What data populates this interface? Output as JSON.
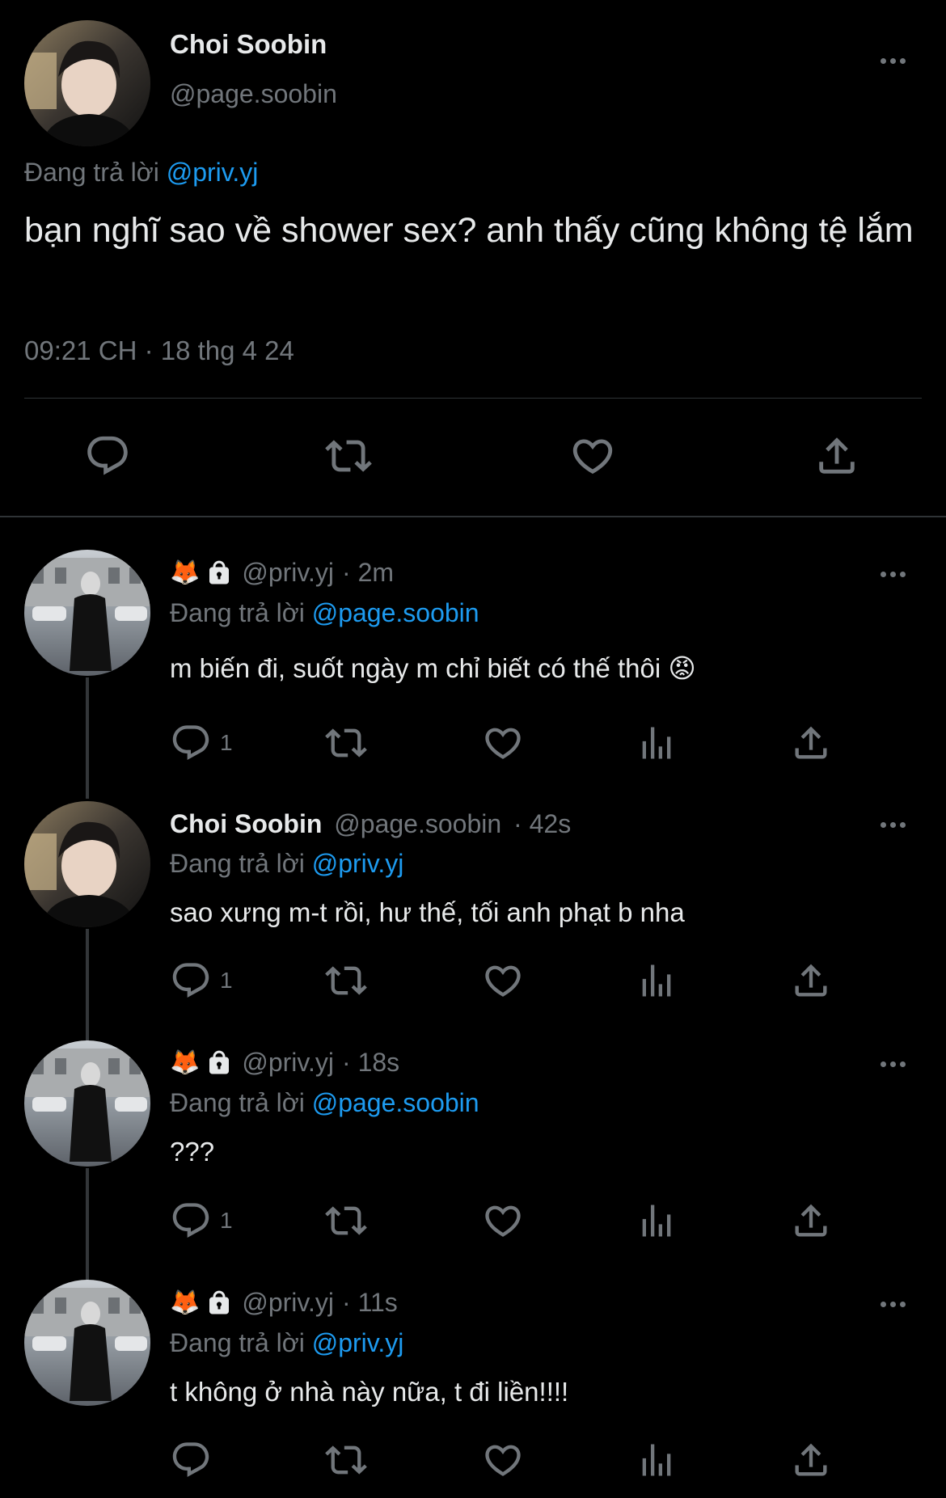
{
  "main": {
    "name": "Choi Soobin",
    "handle": "@page.soobin",
    "reply_prefix": "Đang trả lời",
    "reply_to": "@priv.yj",
    "text": "bạn nghĩ sao về shower sex? anh thấy cũng không tệ lắm",
    "timestamp": "09:21 CH · 18 thg 4 24"
  },
  "replies": [
    {
      "emoji": "🦊",
      "handle": "@priv.yj",
      "time": "· 2m",
      "reply_prefix": "Đang trả lời",
      "reply_to": "@page.soobin",
      "text": "m biến đi, suốt ngày m chỉ biết có thế thôi 😡",
      "reply_count": "1"
    },
    {
      "name": "Choi Soobin",
      "handle": "@page.soobin",
      "time": "· 42s",
      "reply_prefix": "Đang trả lời",
      "reply_to": "@priv.yj",
      "text": "sao xưng m-t rồi, hư thế, tối anh phạt b nha",
      "reply_count": "1"
    },
    {
      "emoji": "🦊",
      "handle": "@priv.yj",
      "time": "· 18s",
      "reply_prefix": "Đang trả lời",
      "reply_to": "@page.soobin",
      "text": "???",
      "reply_count": "1"
    },
    {
      "emoji": "🦊",
      "handle": "@priv.yj",
      "time": "· 11s",
      "reply_prefix": "Đang trả lời",
      "reply_to": "@priv.yj",
      "text": "t không ở nhà này nữa, t đi liền!!!!",
      "reply_count": ""
    }
  ],
  "icons": {
    "more": "more-icon",
    "reply": "reply-icon",
    "retweet": "retweet-icon",
    "like": "like-icon",
    "views": "views-icon",
    "share": "share-icon",
    "lock": "lock-icon"
  },
  "colors": {
    "background": "#000000",
    "text": "#e7e9ea",
    "muted": "#71767b",
    "link": "#1d9bf0",
    "divider": "#2f3336"
  }
}
